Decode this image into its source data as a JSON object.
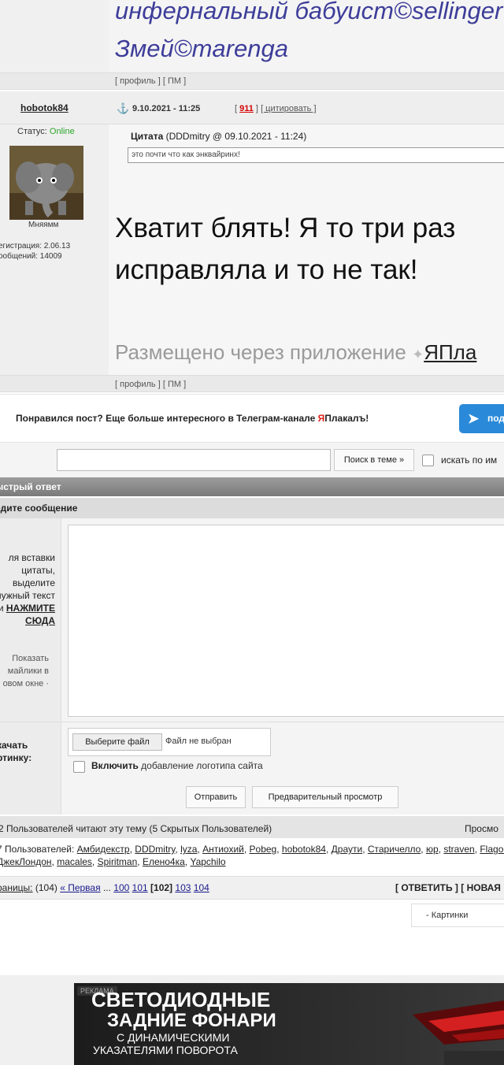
{
  "signature": {
    "line1": "инфернальный бабуист©sellinger",
    "line2": "Змей©marenga"
  },
  "links_top": {
    "profile": "[ профиль ]",
    "pm": "[ ПМ ]"
  },
  "post": {
    "author": "hobotok84",
    "date": "9.10.2021 - 11:25",
    "number_open": "[ ",
    "number": "911",
    "number_close": " ]",
    "quote_link": "[ цитировать ]",
    "status_label": "Статус: ",
    "status_value": "Online",
    "avatar_caption": "Мняямм",
    "registered": "егистрация: 2.06.13",
    "messages": "ообщений: 14009",
    "quote_label": "Цитата",
    "quote_author": " (DDDmitry @ 09.10.2021 - 11:24)",
    "quote_text": "это почти что как энквайринх!",
    "text_line1": "Хватит блять! Я то три раз",
    "text_line2": "исправляла и то не так!",
    "via_text": "Размещено через приложение ",
    "via_app": "ЯПла"
  },
  "links_bottom": {
    "profile": "[ профиль ]",
    "pm": "[ ПМ ]"
  },
  "telegram": {
    "text_before": "Понравился пост? Еще больше интересного в Телеграм-канале ",
    "brand_ya": "Я",
    "brand_rest": "Плакалъ!",
    "button_label": "под"
  },
  "search": {
    "button_label": "Поиск в теме »",
    "checkbox_label": "искать по им"
  },
  "quick_reply": {
    "header": "ыстрый ответ",
    "subheader": "едите сообщение",
    "hint": "ля вставки цитаты, выделите нужный текст и",
    "hint_action": "НАЖМИТЕ СЮДА",
    "smiles_link": "Показать майлики в овом окне",
    "smiles_suffix": " ·",
    "upload_label": "качать ртинку:",
    "file_button": "Выберите файл",
    "file_status": "Файл не выбран",
    "logo_bold": "Включить",
    "logo_rest": " добавление логотипа сайта",
    "send_button": "Отправить",
    "preview_button": "Предварительный просмотр"
  },
  "readers": {
    "summary": "2 Пользователей читают эту тему (5 Скрытых Пользователей)",
    "right": "Просмо",
    "users_prefix": "7 Пользователей: ",
    "users": [
      "Амбидекстр",
      "DDDmitry",
      "lyza",
      "Антиохий",
      "Pobeg",
      "hobotok84",
      "Драути",
      "Старичелло",
      "юр",
      "straven",
      "Flagon",
      "ДжекЛондон",
      "macales",
      "Spiritman",
      "Елено4ка",
      "Yapchilo"
    ]
  },
  "pagination": {
    "label": "раницы:",
    "count": " (104) ",
    "first": "« Первая",
    "dots": " ... ",
    "p100": "100",
    "p101": "101",
    "current": "[102]",
    "p103": "103",
    "p104": "104",
    "actions": "[ ОТВЕТИТЬ ] [ НОВАЯ"
  },
  "pictures_select": "- Картинки",
  "ad": {
    "tag": "РЕКЛАМА",
    "line1": "СВЕТОДИОДНЫЕ",
    "line2": "ЗАДНИЕ ФОНАРИ",
    "line3": "С ДИНАМИЧЕСКИМИ",
    "line4": "УКАЗАТЕЛЯМИ ПОВОРОТА"
  },
  "colors": {
    "online": "#2aa52a",
    "post_number": "#d40000",
    "telegram_button": "#2a8ad9",
    "signature": "#3d3d9a"
  }
}
